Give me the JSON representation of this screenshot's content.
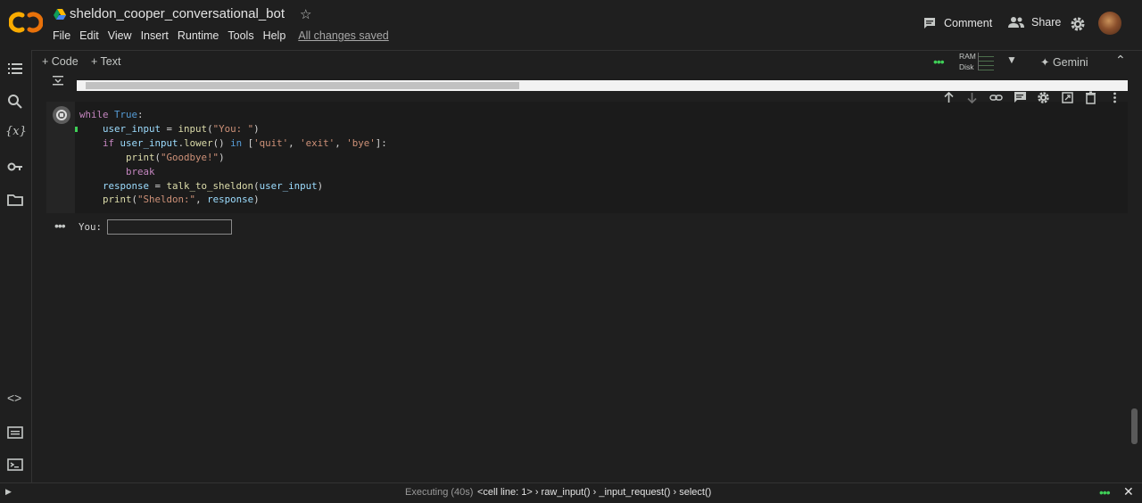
{
  "app": {
    "notebook_title": "sheldon_cooper_conversational_bot",
    "menu": [
      "File",
      "Edit",
      "View",
      "Insert",
      "Runtime",
      "Tools",
      "Help"
    ],
    "save_status": "All changes saved",
    "comment_label": "Comment",
    "share_label": "Share"
  },
  "toolbar": {
    "add_code": "+ Code",
    "add_text": "+ Text",
    "ram_label": "RAM",
    "disk_label": "Disk",
    "gemini_label": "Gemini"
  },
  "cell": {
    "code_lines": [
      "while True:",
      "    user_input = input(\"You: \")",
      "    if user_input.lower() in ['quit', 'exit', 'bye']:",
      "        print(\"Goodbye!\")",
      "        break",
      "    response = talk_to_sheldon(user_input)",
      "    print(\"Sheldon:\", response)"
    ]
  },
  "output": {
    "prompt_label": "You:",
    "input_value": ""
  },
  "statusbar": {
    "executing": "Executing (40s)",
    "trace": "<cell line: 1> › raw_input() › _input_request() › select()"
  },
  "colors": {
    "background": "#1f1f1f",
    "accent_green": "#3fcf57",
    "logo_orange": "#f9ab00"
  }
}
